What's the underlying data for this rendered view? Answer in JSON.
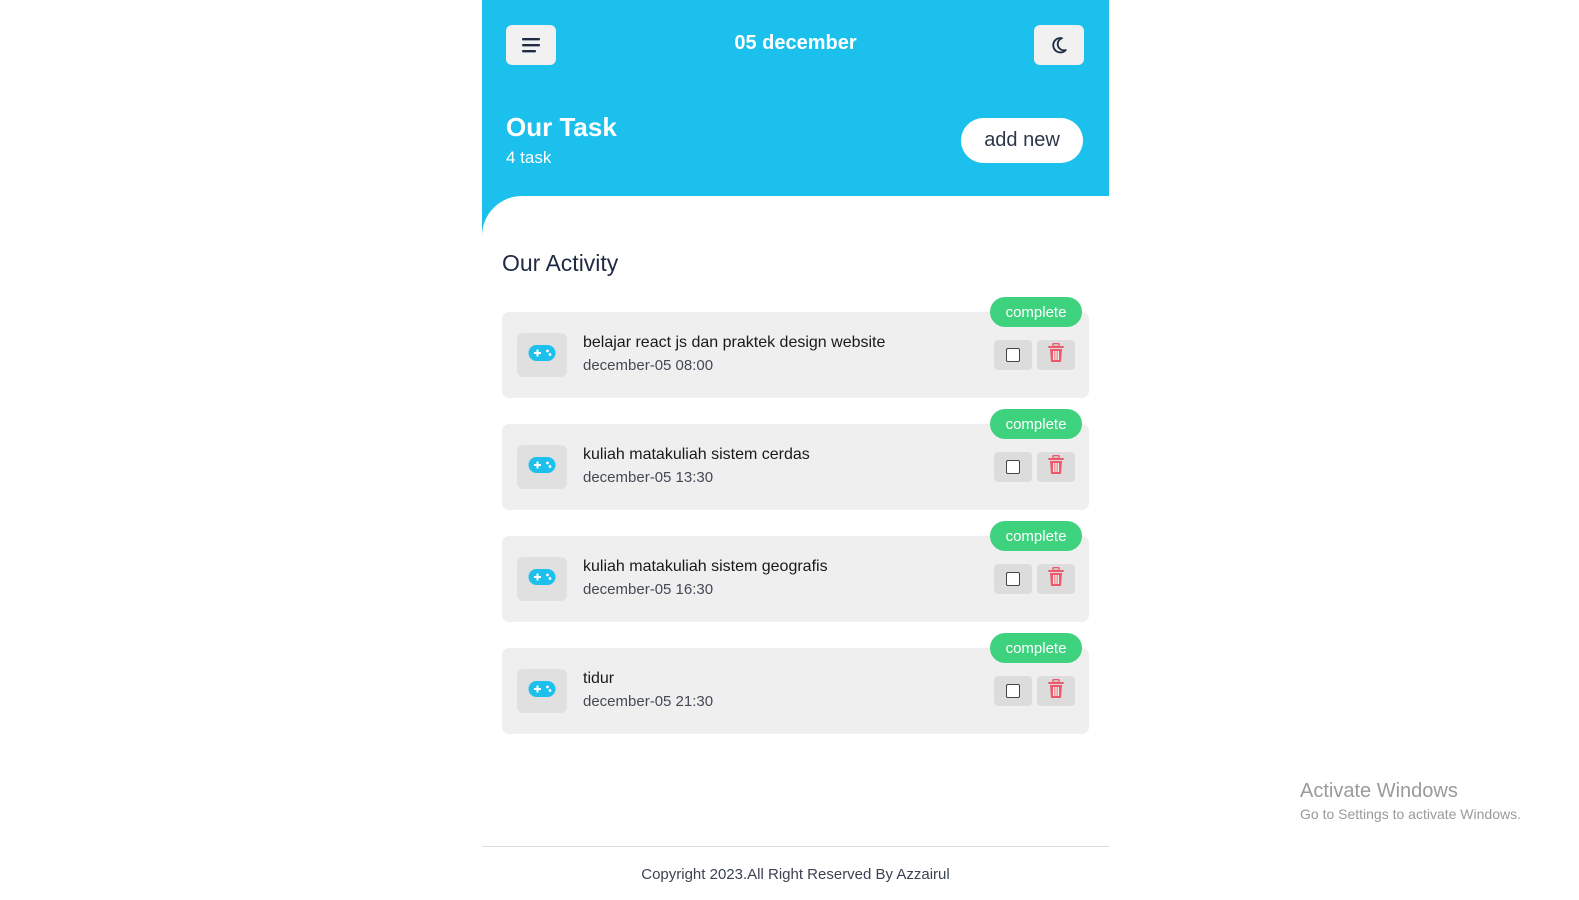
{
  "header": {
    "date": "05 december",
    "title": "Our Task",
    "count": "4 task",
    "add_label": "add new",
    "icons": {
      "menu": "hamburger-menu-icon",
      "theme": "moon-icon"
    }
  },
  "activity": {
    "title": "Our Activity",
    "tasks": [
      {
        "title": "belajar react js dan praktek design website",
        "time": "december-05 08:00",
        "status": "complete"
      },
      {
        "title": "kuliah matakuliah sistem cerdas",
        "time": "december-05 13:30",
        "status": "complete"
      },
      {
        "title": "kuliah matakuliah sistem geografis",
        "time": "december-05 16:30",
        "status": "complete"
      },
      {
        "title": "tidur",
        "time": "december-05 21:30",
        "status": "complete"
      }
    ],
    "task_icon": "gamepad-icon"
  },
  "footer": {
    "text": "Copyright 2023.All Right Reserved By Azzairul"
  },
  "watermark": {
    "title": "Activate Windows",
    "subtitle": "Go to Settings to activate Windows."
  },
  "colors": {
    "primary": "#1bc0ec",
    "complete": "#3ed27e",
    "delete": "#ee5a6c",
    "card_bg": "#efefef"
  }
}
